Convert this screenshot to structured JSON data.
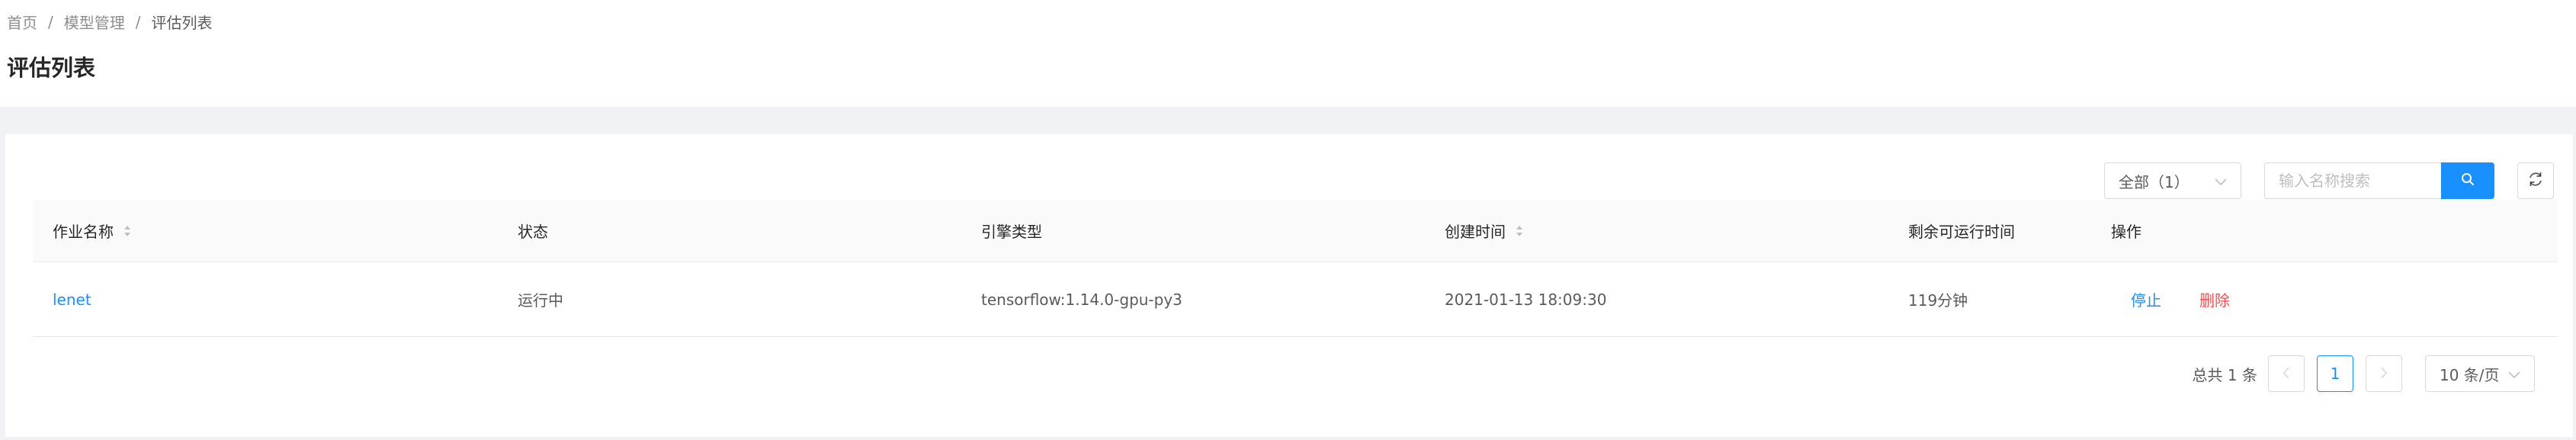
{
  "breadcrumb": {
    "items": [
      "首页",
      "模型管理",
      "评估列表"
    ],
    "separator": "/"
  },
  "page": {
    "title": "评估列表"
  },
  "toolbar": {
    "filter_value": "全部（1）",
    "search_placeholder": "输入名称搜索"
  },
  "table": {
    "headers": [
      "作业名称",
      "状态",
      "引擎类型",
      "创建时间",
      "剩余可运行时间",
      "操作"
    ],
    "rows": [
      {
        "name": "lenet",
        "status": "运行中",
        "engine": "tensorflow:1.14.0-gpu-py3",
        "created": "2021-01-13 18:09:30",
        "remaining": "119分钟",
        "actions": [
          "停止",
          "删除"
        ]
      }
    ]
  },
  "pagination": {
    "total_text": "总共 1 条",
    "current_page": "1",
    "page_size": "10 条/页"
  },
  "colors": {
    "primary": "#1890ff",
    "danger": "#ff4d4f",
    "background": "#f0f2f5"
  }
}
